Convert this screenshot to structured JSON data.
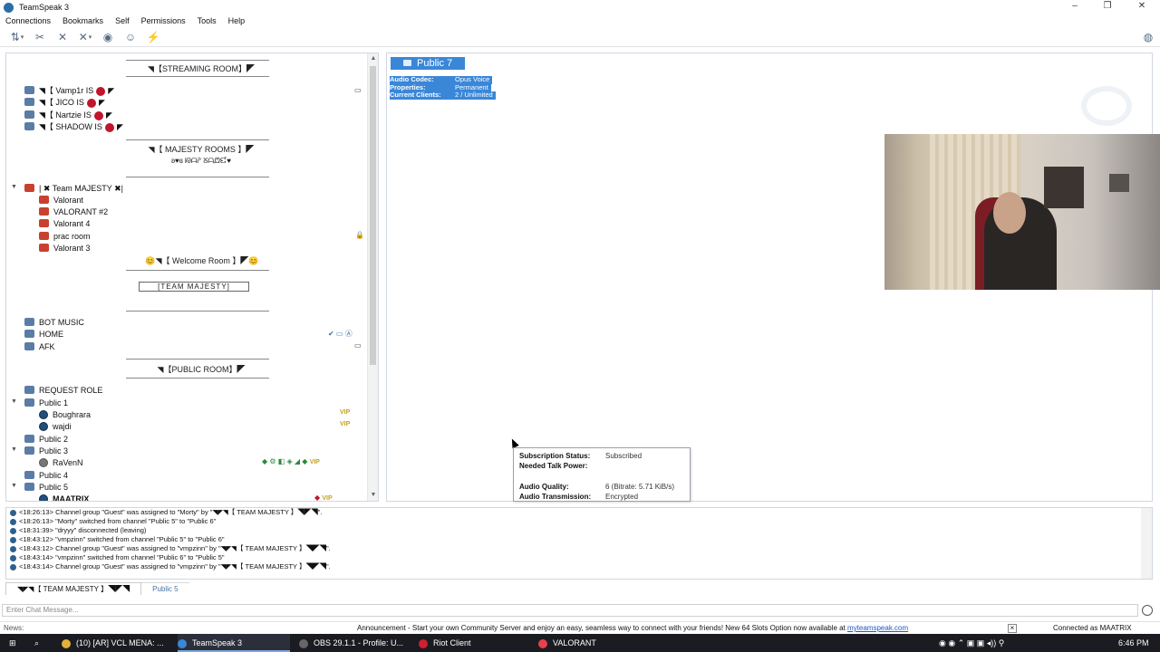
{
  "window": {
    "title": "TeamSpeak 3",
    "controls": [
      "–",
      "❐",
      "✕"
    ]
  },
  "menu": [
    "Connections",
    "Bookmarks",
    "Self",
    "Permissions",
    "Tools",
    "Help"
  ],
  "toolbar": {
    "icons": [
      "connect-icon",
      "disconnect-icon",
      "mute-mic-icon",
      "mute-speaker-icon",
      "away-icon",
      "contacts-icon",
      "hotkeys-icon"
    ],
    "right_icon": "network-icon"
  },
  "tree": {
    "streaming_header": "◥【STREAMING ROOM】◤",
    "streaming_users": [
      "◥【 Vamp1r IS",
      "◥【 JICO IS",
      "◥【 Nartzie IS",
      "◥【 SHADOW IS"
    ],
    "majesty_header": "◥【 MAJESTY ROOMS 】◤",
    "majesty_sub": "ʚ♥ɞ ᘙᗩᕈ  ᘜᗩᘻᘿ♥",
    "team_majesty": "| ✖ Team MAJESTY ✖|",
    "team_channels": [
      "Valorant",
      "VALORANT #2",
      "Valorant 4",
      "prac room",
      "Valorant 3"
    ],
    "welcome_header": "😊◥【 Welcome Room 】◤😊",
    "welcome_sub": "[TEAM MAJESTY]",
    "misc_channels": [
      "BOT MUSIC",
      "HOME",
      "AFK"
    ],
    "public_header": "◥【PUBLIC ROOM】◤",
    "request_role": "REQUEST ROLE",
    "public1": "Public 1",
    "public1_users": [
      "Boughrara",
      "wajdi"
    ],
    "public2": "Public 2",
    "public3": "Public 3",
    "public3_user": "RaVenN",
    "public4": "Public 4",
    "public5": "Public 5",
    "public5_user": "MAATRIX",
    "vip_badge": "VIP"
  },
  "info": {
    "channel_title": "Public 7",
    "audio_codec_label": "Audio Codec:",
    "audio_codec": "Opus Voice",
    "properties_label": "Properties:",
    "properties": "Permanent",
    "clients_label": "Current Clients:",
    "clients": "2 / Unlimited"
  },
  "tooltip": {
    "subscription_label": "Subscription Status:",
    "subscription": "Subscribed",
    "talk_power_label": "Needed Talk Power:",
    "talk_power": "",
    "audio_quality_label": "Audio Quality:",
    "audio_quality": "6 (Bitrate: 5.71 KiB/s)",
    "transmission_label": "Audio Transmission:",
    "transmission": "Encrypted"
  },
  "log": [
    {
      "time": "<18:26:13>",
      "text": "Channel group \"Guest\" was assigned to \"Morty\" by \"◥◤◥【 TEAM MAJESTY 】◥◤◥\"."
    },
    {
      "time": "<18:26:13>",
      "text": "\"Morty\" switched from channel \"Public 5\" to \"Public 6\""
    },
    {
      "time": "<18:31:39>",
      "text": "\"dryyy\" disconnected (leaving)"
    },
    {
      "time": "<18:43:12>",
      "text": "\"vmpzinn\" switched from channel \"Public 5\" to \"Public 6\""
    },
    {
      "time": "<18:43:12>",
      "text": "Channel group \"Guest\" was assigned to \"vmpzinn\" by \"◥◤◥【 TEAM MAJESTY 】◥◤◥\"."
    },
    {
      "time": "<18:43:14>",
      "text": "\"vmpzinn\" switched from channel \"Public 6\" to \"Public 5\""
    },
    {
      "time": "<18:43:14>",
      "text": "Channel group \"Guest\" was assigned to \"vmpzinn\" by \"◥◤◥【 TEAM MAJESTY 】◥◤◥\"."
    }
  ],
  "tabs": [
    "◥◤◥【 TEAM MAJESTY 】◥◤◥",
    "Public 5"
  ],
  "chat_placeholder": "Enter Chat Message...",
  "status": {
    "news": "News:",
    "announcement": "Announcement - Start your own Community Server and enjoy an easy, seamless way to connect with your friends! New 64 Slots Option now available at ",
    "link": "myteamspeak.com",
    "connected": "Connected as MAATRIX"
  },
  "taskbar": {
    "items": [
      "(10) [AR] VCL MENA: ...",
      "TeamSpeak 3",
      "OBS 29.1.1 - Profile: U...",
      "Riot Client",
      "VALORANT"
    ],
    "time": "6:46 PM"
  },
  "colors": {
    "accent": "#3a87d8",
    "taskbar": "#1a1c22",
    "channel_red": "#c8412e",
    "channel_blue": "#5b7da5"
  }
}
